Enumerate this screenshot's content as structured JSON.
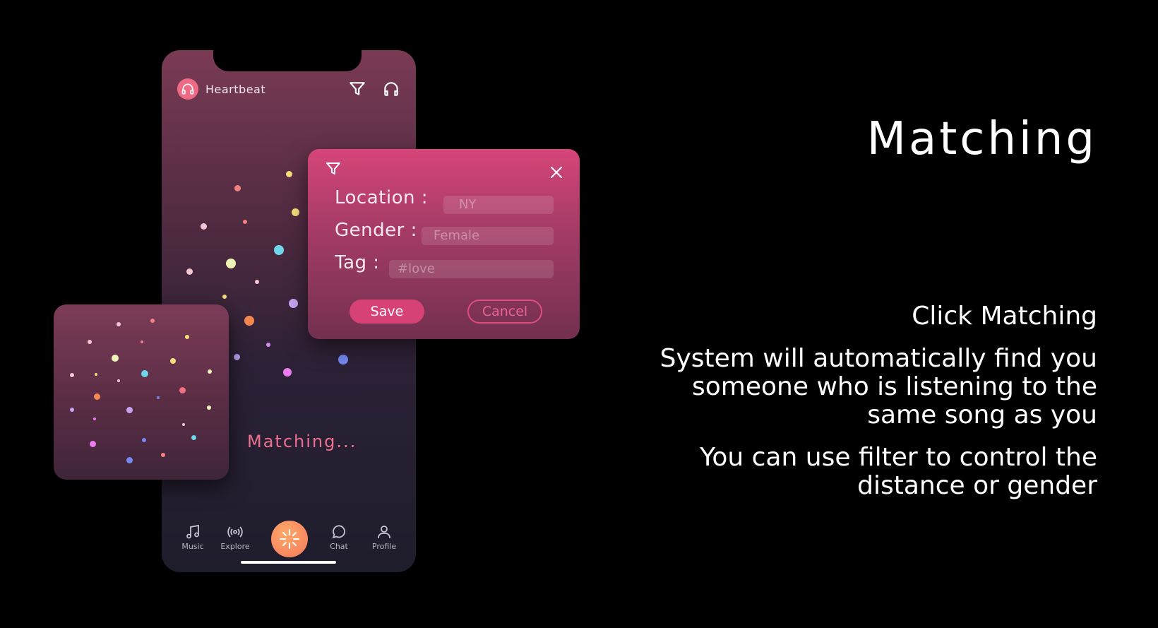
{
  "app": {
    "name": "Heartbeat"
  },
  "matching_status": "Matching...",
  "nav": {
    "items": [
      {
        "label": "Music",
        "icon": "music-note-icon"
      },
      {
        "label": "Explore",
        "icon": "broadcast-icon"
      },
      {
        "label": "Chat",
        "icon": "chat-bubble-icon"
      },
      {
        "label": "Profile",
        "icon": "person-icon"
      }
    ],
    "center_icon": "matching-burst-icon"
  },
  "filter_dialog": {
    "location_label": "Location :",
    "location_placeholder": "NY",
    "gender_label": "Gender :",
    "gender_placeholder": "Female",
    "tag_label": "Tag :",
    "tag_placeholder": "#love",
    "save_label": "Save",
    "cancel_label": "Cancel"
  },
  "slide": {
    "title": "Matching",
    "subtitle": "Click Matching",
    "description": "System will automatically find you someone who is listening to the same song as you",
    "note": "You can use filter to control the distance or gender"
  },
  "colors": {
    "accent": "#d64276",
    "matching_button": "#f5795a",
    "background": "#000000"
  }
}
